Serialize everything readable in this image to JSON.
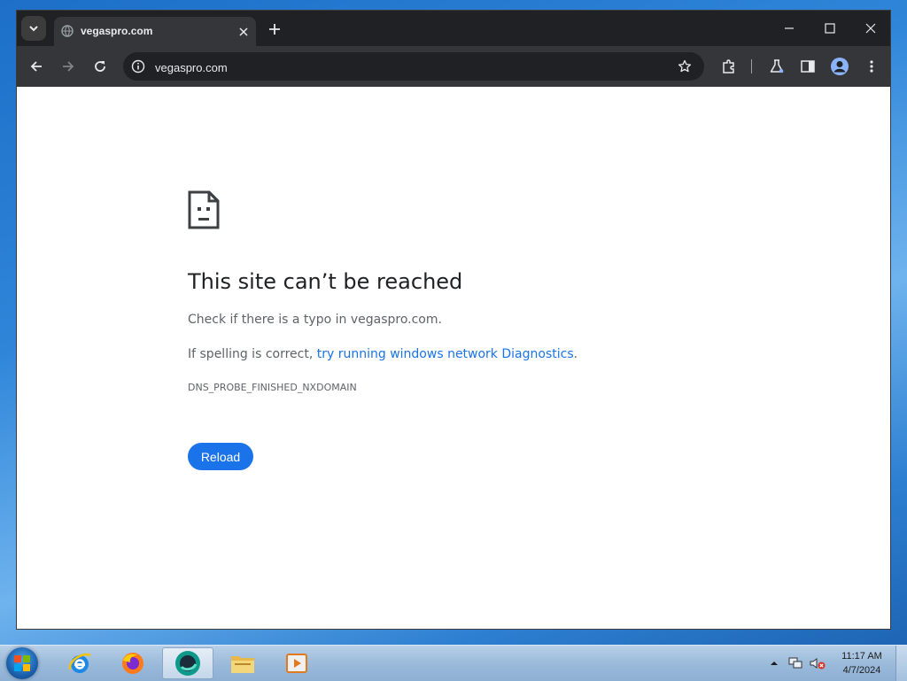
{
  "browser": {
    "tab": {
      "title": "vegaspro.com"
    },
    "omnibox": {
      "url": "vegaspro.com"
    }
  },
  "error_page": {
    "title": "This site can’t be reached",
    "line1": "Check if there is a typo in vegaspro.com.",
    "line2_prefix": "If spelling is correct, ",
    "line2_link": "try running windows network Diagnostics",
    "line2_suffix": ".",
    "error_code": "DNS_PROBE_FINISHED_NXDOMAIN",
    "reload_label": "Reload"
  },
  "taskbar": {
    "apps": [
      "internet-explorer",
      "firefox",
      "chrome-like-browser",
      "file-explorer",
      "media-player"
    ],
    "clock_time": "11:17 AM",
    "clock_date": "4/7/2024"
  },
  "colors": {
    "accent": "#1a73e8",
    "chrome_dark": "#202124",
    "chrome_toolbar": "#35363a"
  }
}
